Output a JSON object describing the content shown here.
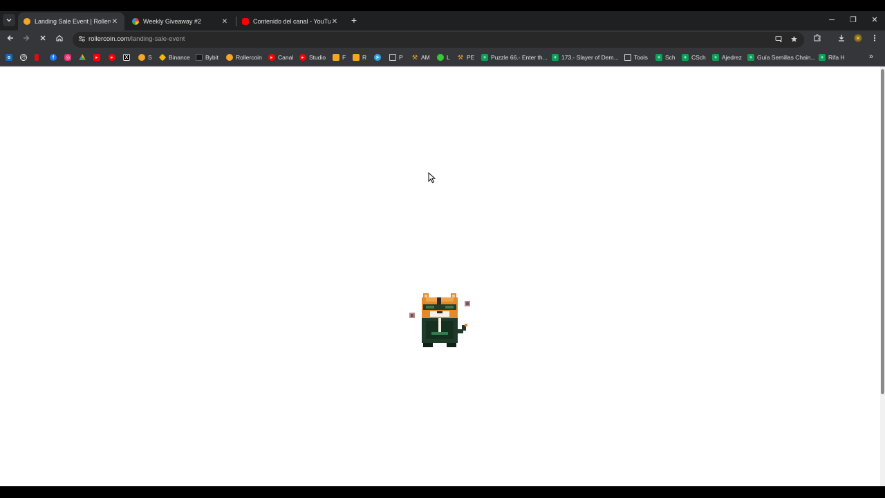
{
  "browser": {
    "tabs": [
      {
        "title": "Landing Sale Event | RollerCoin",
        "active": true
      },
      {
        "title": "Weekly Giveaway #2",
        "active": false
      },
      {
        "title": "Contenido del canal - YouTube",
        "active": false
      }
    ],
    "new_tab_symbol": "+",
    "window_controls": {
      "minimize": "─",
      "restore": "❐",
      "close": "✕"
    },
    "tab_close_symbol": "✕"
  },
  "toolbar": {
    "url_domain": "rollercoin.com",
    "url_path": "/landing-sale-event",
    "back_icon": "arrow-left-icon",
    "forward_icon": "arrow-right-icon",
    "stop_icon": "stop-loading-icon",
    "home_icon": "home-icon"
  },
  "bookmarks": {
    "items": [
      {
        "label": "",
        "icon": "outlook-icon",
        "color": "#0f6cbd"
      },
      {
        "label": "",
        "icon": "threads-icon",
        "color": "#000000"
      },
      {
        "label": "",
        "icon": "netflix-icon",
        "color": "#e50914"
      },
      {
        "label": "",
        "icon": "facebook-icon",
        "color": "#1877f2"
      },
      {
        "label": "",
        "icon": "instagram-icon",
        "color": "#e1306c"
      },
      {
        "label": "",
        "icon": "drive-icon",
        "color": "#34a853"
      },
      {
        "label": "",
        "icon": "youtube-icon",
        "color": "#ff0000"
      },
      {
        "label": "",
        "icon": "yahoo-icon",
        "color": "#8e44ad"
      },
      {
        "label": "",
        "icon": "x-icon",
        "color": "#000000"
      },
      {
        "label": "S",
        "icon": "rollercoin-icon",
        "color": "#f5a623"
      },
      {
        "label": "Binance",
        "icon": "binance-icon",
        "color": "#f0b90b"
      },
      {
        "label": "Bybit",
        "icon": "bybit-icon",
        "color": "#17181e"
      },
      {
        "label": "Rollercoin",
        "icon": "rollercoin-icon",
        "color": "#f5a623"
      },
      {
        "label": "Canal",
        "icon": "youtube-icon",
        "color": "#ff0000"
      },
      {
        "label": "Studio",
        "icon": "youtube-studio-icon",
        "color": "#ff0000"
      },
      {
        "label": "F",
        "icon": "cat-icon",
        "color": "#f5a623"
      },
      {
        "label": "R",
        "icon": "cat-icon",
        "color": "#f5a623"
      },
      {
        "label": "",
        "icon": "telegram-icon",
        "color": "#29a9eb"
      },
      {
        "label": "P",
        "icon": "folder-icon",
        "color": "#35363a"
      },
      {
        "label": "AM",
        "icon": "hammer-icon",
        "color": "#f5a623"
      },
      {
        "label": "L",
        "icon": "robot-icon",
        "color": "#33cc33"
      },
      {
        "label": "PE",
        "icon": "hammer-icon",
        "color": "#f5a623"
      },
      {
        "label": "Puzzle 66.- Enter th...",
        "icon": "sheets-icon",
        "color": "#0f9d58"
      },
      {
        "label": "173.- Slayer of Dem...",
        "icon": "sheets-icon",
        "color": "#0f9d58"
      },
      {
        "label": "Tools",
        "icon": "folder-icon",
        "color": "#35363a"
      },
      {
        "label": "Sch",
        "icon": "sheets-icon",
        "color": "#0f9d58"
      },
      {
        "label": "CSch",
        "icon": "sheets-icon",
        "color": "#0f9d58"
      },
      {
        "label": "Ajedrez",
        "icon": "sheets-icon",
        "color": "#0f9d58"
      },
      {
        "label": "Guía Semillas Chain...",
        "icon": "sheets-icon",
        "color": "#0f9d58"
      },
      {
        "label": "Rifa H",
        "icon": "sheets-icon",
        "color": "#0f9d58"
      }
    ],
    "more_symbol": "»"
  },
  "page": {
    "state": "loading",
    "mascot": "pixel-cat-loader-icon",
    "background": "#ffffff"
  }
}
